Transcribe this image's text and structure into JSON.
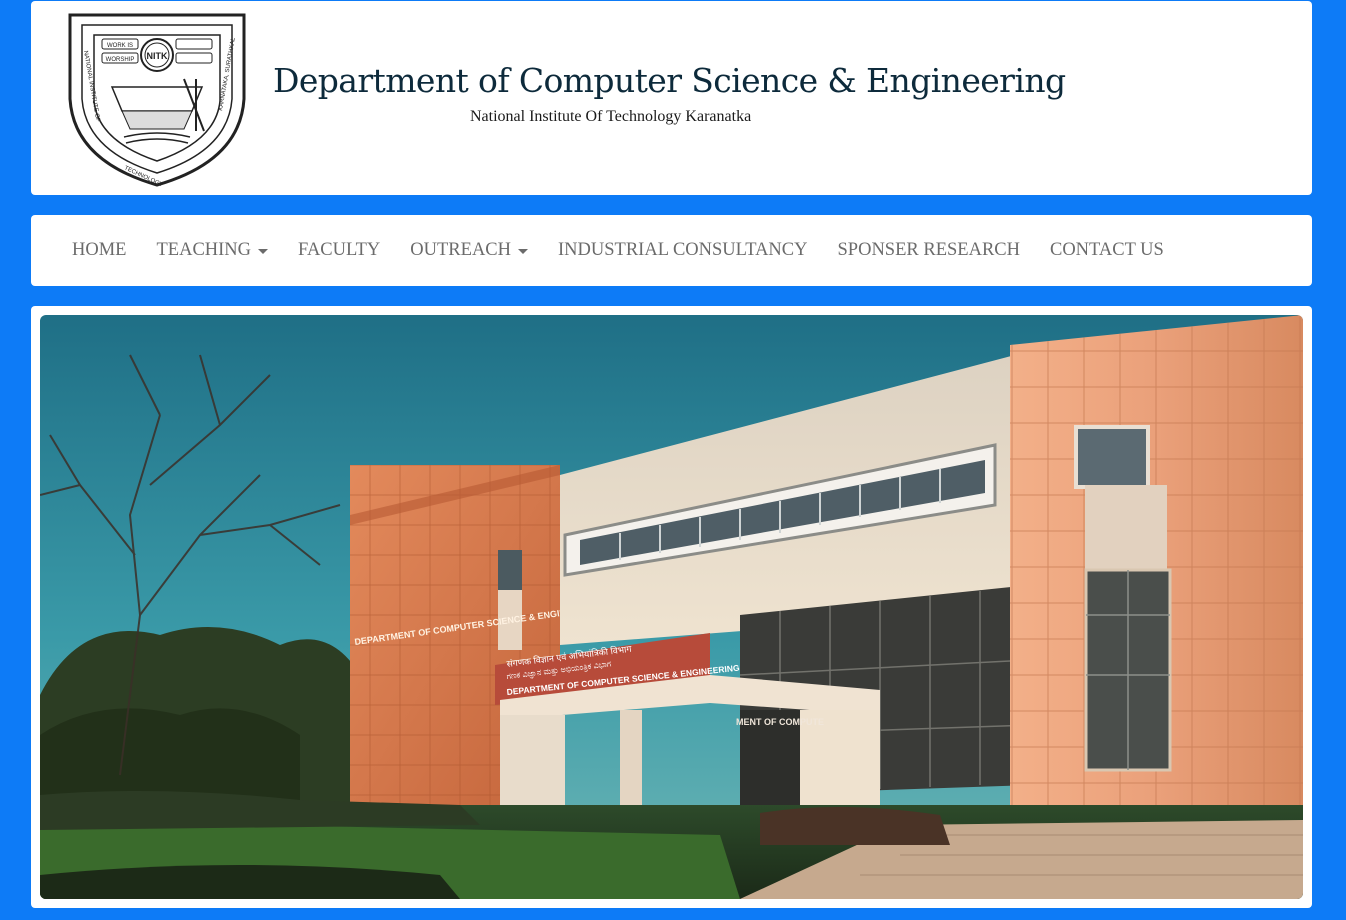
{
  "header": {
    "title": "Department of Computer Science & Engineering",
    "subtitle": "National Institute Of Technology Karanatka",
    "logo": {
      "motto_left": "WORK IS WORSHIP",
      "emblem_text": "NITK",
      "ring_text": "NATIONAL INSTITUTE OF TECHNOLOGY KARNATAKA, SURATHKAL"
    }
  },
  "nav": {
    "items": [
      {
        "label": "HOME",
        "dropdown": false
      },
      {
        "label": "TEACHING",
        "dropdown": true
      },
      {
        "label": "FACULTY",
        "dropdown": false
      },
      {
        "label": "OUTREACH",
        "dropdown": true
      },
      {
        "label": "INDUSTRIAL CONSULTANCY",
        "dropdown": false
      },
      {
        "label": "SPONSER RESEARCH",
        "dropdown": false
      },
      {
        "label": "CONTACT US",
        "dropdown": false
      }
    ]
  },
  "hero": {
    "sign_side": "DEPARTMENT OF COMPUTER SCIENCE & ENGINEERING",
    "sign_hindi": "संगणक विज्ञान एवं अभियांत्रिकी विभाग",
    "sign_kannada": "ಗಣಕ ವಿಜ್ಞಾನ ಮತ್ತು ಅಭಿಯಂತ್ರಿಕ ವಿಭಾಗ",
    "sign_main": "DEPARTMENT OF COMPUTER SCIENCE & ENGINEERING",
    "sign_inner": "MENT OF COMPUTE"
  },
  "colors": {
    "page_bg": "#0d7bf7",
    "card_bg": "#ffffff",
    "title": "#0d2a3b",
    "nav_text": "#6b6b6b"
  }
}
